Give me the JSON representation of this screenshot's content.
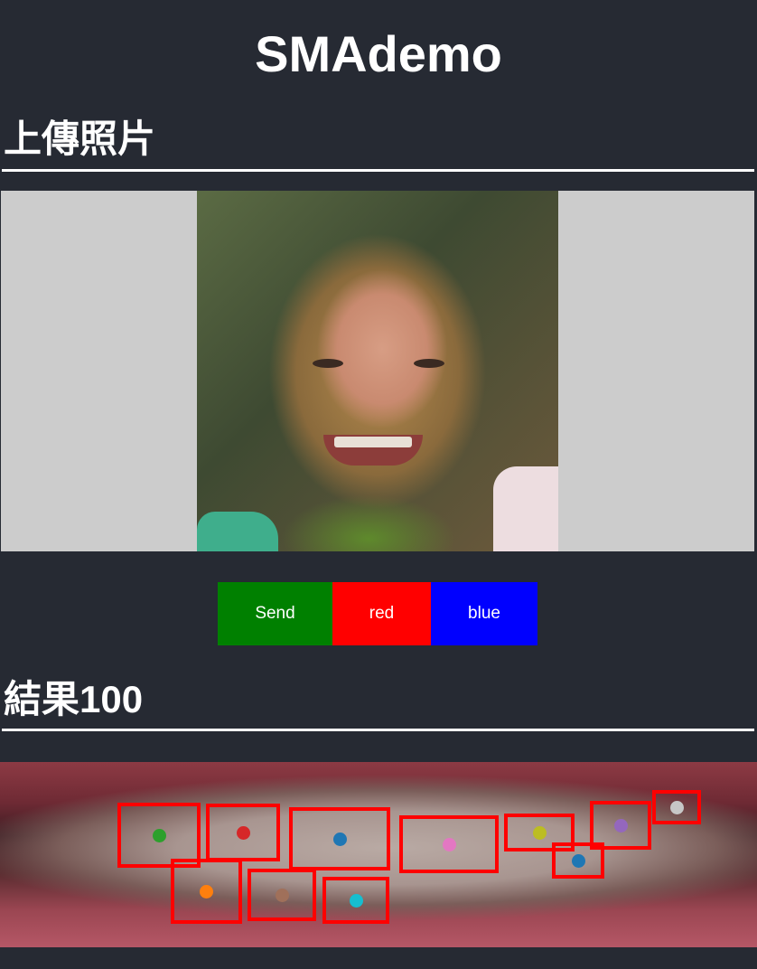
{
  "app": {
    "title": "SMAdemo"
  },
  "upload": {
    "heading": "上傳照片"
  },
  "buttons": {
    "send": "Send",
    "red": "red",
    "blue": "blue"
  },
  "result": {
    "heading": "結果100"
  },
  "colors": {
    "background": "#262a33",
    "send": "#008000",
    "red": "#ff0000",
    "blue": "#0000ff",
    "box": "#ff0000"
  },
  "tooth_markers": [
    {
      "color": "#2ca02c"
    },
    {
      "color": "#d62728"
    },
    {
      "color": "#1f77b4"
    },
    {
      "color": "#e377c2"
    },
    {
      "color": "#bcbd22"
    },
    {
      "color": "#9467bd"
    },
    {
      "color": "#c7c7c7"
    },
    {
      "color": "#1f77b4"
    },
    {
      "color": "#ff7f0e"
    },
    {
      "color": "#a0705a"
    },
    {
      "color": "#17becf"
    }
  ]
}
